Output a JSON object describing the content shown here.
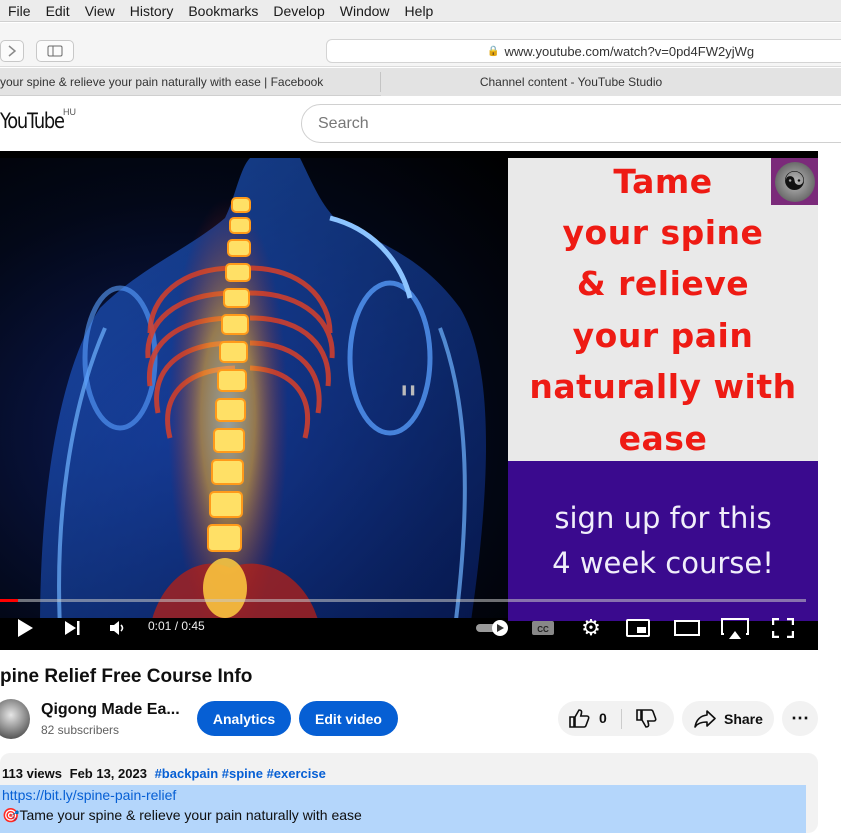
{
  "menu": [
    "File",
    "Edit",
    "View",
    "History",
    "Bookmarks",
    "Develop",
    "Window",
    "Help"
  ],
  "browser": {
    "url": "www.youtube.com/watch?v=0pd4FW2yjWg",
    "tabs": [
      "your spine & relieve your pain naturally with ease | Facebook",
      "Channel content - YouTube Studio"
    ]
  },
  "youtube": {
    "logo": "YouTube",
    "country": "HU",
    "search_placeholder": "Search"
  },
  "thumbnail": {
    "red_lines": [
      "Tame",
      "your spine",
      "& relieve",
      "your pain",
      "naturally with",
      "ease"
    ],
    "white_lines": [
      "sign up for this",
      "4 week course!"
    ],
    "colors": {
      "red_text": "#ee1b14",
      "purple_panel": "#3a0a8e",
      "grey_panel": "#e9e9e9"
    }
  },
  "player": {
    "time": "0:01 / 0:45",
    "progress_fraction": 0.022,
    "icons": [
      "play-icon",
      "next-icon",
      "volume-icon",
      "autoplay-toggle-icon",
      "captions-icon",
      "settings-icon",
      "miniplayer-icon",
      "theater-icon",
      "airplay-icon",
      "fullscreen-icon"
    ]
  },
  "video": {
    "title": "pine Relief Free Course Info"
  },
  "channel": {
    "name": "Qigong Made Ea...",
    "subscribers": "82 subscribers"
  },
  "actions": {
    "analytics": "Analytics",
    "edit_video": "Edit video",
    "likes": "0",
    "share": "Share"
  },
  "description": {
    "views": "113 views",
    "date": "Feb 13, 2023",
    "tags": "#backpain #spine #exercise",
    "link": "https://bit.ly/spine-pain-relief",
    "first_line": "Tame your spine & relieve your pain naturally with ease"
  },
  "colors": {
    "accent_blue": "#065fd4",
    "progress_red": "#ff0000",
    "selection": "#b4d6fb"
  }
}
